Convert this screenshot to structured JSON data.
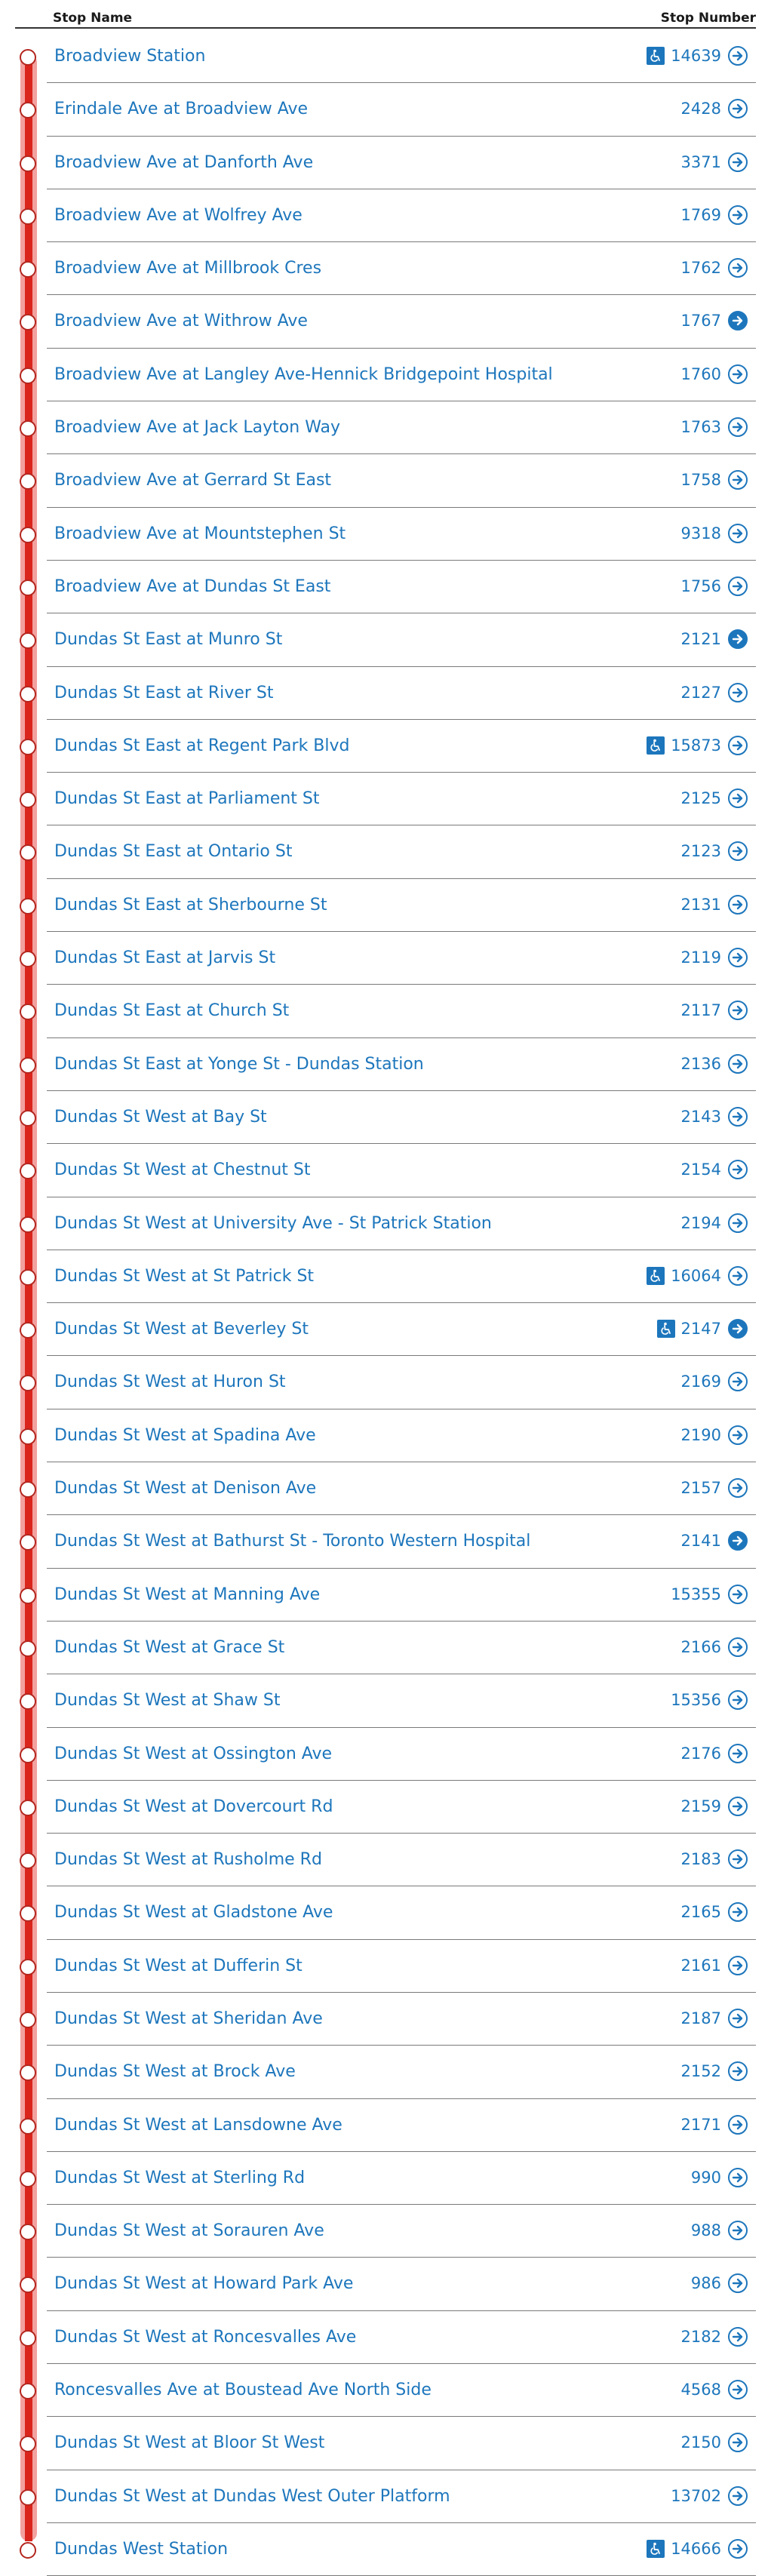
{
  "header": {
    "name_label": "Stop Name",
    "number_label": "Stop Number"
  },
  "colors": {
    "route_line": "#da251d",
    "link": "#1d76bc"
  },
  "stops": [
    {
      "name": "Broadview Station",
      "number": "14639",
      "accessible": true,
      "arrow": "outline"
    },
    {
      "name": "Erindale Ave at Broadview Ave",
      "number": "2428",
      "accessible": false,
      "arrow": "outline"
    },
    {
      "name": "Broadview Ave at Danforth Ave",
      "number": "3371",
      "accessible": false,
      "arrow": "outline"
    },
    {
      "name": "Broadview Ave at Wolfrey Ave",
      "number": "1769",
      "accessible": false,
      "arrow": "outline"
    },
    {
      "name": "Broadview Ave at Millbrook Cres",
      "number": "1762",
      "accessible": false,
      "arrow": "outline"
    },
    {
      "name": "Broadview Ave at Withrow Ave",
      "number": "1767",
      "accessible": false,
      "arrow": "filled"
    },
    {
      "name": "Broadview Ave at Langley Ave-Hennick Bridgepoint Hospital",
      "number": "1760",
      "accessible": false,
      "arrow": "outline"
    },
    {
      "name": "Broadview Ave at Jack Layton Way",
      "number": "1763",
      "accessible": false,
      "arrow": "outline"
    },
    {
      "name": "Broadview Ave at Gerrard St East",
      "number": "1758",
      "accessible": false,
      "arrow": "outline"
    },
    {
      "name": "Broadview Ave at Mountstephen St",
      "number": "9318",
      "accessible": false,
      "arrow": "outline"
    },
    {
      "name": "Broadview Ave at Dundas St East",
      "number": "1756",
      "accessible": false,
      "arrow": "outline"
    },
    {
      "name": "Dundas St East at Munro St",
      "number": "2121",
      "accessible": false,
      "arrow": "filled"
    },
    {
      "name": "Dundas St East at River St",
      "number": "2127",
      "accessible": false,
      "arrow": "outline"
    },
    {
      "name": "Dundas St East at Regent Park Blvd",
      "number": "15873",
      "accessible": true,
      "arrow": "outline"
    },
    {
      "name": "Dundas St East at Parliament St",
      "number": "2125",
      "accessible": false,
      "arrow": "outline"
    },
    {
      "name": "Dundas St East at Ontario St",
      "number": "2123",
      "accessible": false,
      "arrow": "outline"
    },
    {
      "name": "Dundas St East at Sherbourne St",
      "number": "2131",
      "accessible": false,
      "arrow": "outline"
    },
    {
      "name": "Dundas St East at Jarvis St",
      "number": "2119",
      "accessible": false,
      "arrow": "outline"
    },
    {
      "name": "Dundas St East at Church St",
      "number": "2117",
      "accessible": false,
      "arrow": "outline"
    },
    {
      "name": "Dundas St East at Yonge St - Dundas Station",
      "number": "2136",
      "accessible": false,
      "arrow": "outline"
    },
    {
      "name": "Dundas St West at Bay St",
      "number": "2143",
      "accessible": false,
      "arrow": "outline"
    },
    {
      "name": "Dundas St West at Chestnut St",
      "number": "2154",
      "accessible": false,
      "arrow": "outline"
    },
    {
      "name": "Dundas St West at University Ave - St Patrick Station",
      "number": "2194",
      "accessible": false,
      "arrow": "outline"
    },
    {
      "name": "Dundas St West at St Patrick St",
      "number": "16064",
      "accessible": true,
      "arrow": "outline"
    },
    {
      "name": "Dundas St West at Beverley St",
      "number": "2147",
      "accessible": true,
      "arrow": "filled"
    },
    {
      "name": "Dundas St West at Huron St",
      "number": "2169",
      "accessible": false,
      "arrow": "outline"
    },
    {
      "name": "Dundas St West at Spadina Ave",
      "number": "2190",
      "accessible": false,
      "arrow": "outline"
    },
    {
      "name": "Dundas St West at Denison Ave",
      "number": "2157",
      "accessible": false,
      "arrow": "outline"
    },
    {
      "name": "Dundas St West at Bathurst St - Toronto Western Hospital",
      "number": "2141",
      "accessible": false,
      "arrow": "filled"
    },
    {
      "name": "Dundas St West at Manning Ave",
      "number": "15355",
      "accessible": false,
      "arrow": "outline"
    },
    {
      "name": "Dundas St West at Grace St",
      "number": "2166",
      "accessible": false,
      "arrow": "outline"
    },
    {
      "name": "Dundas St West at Shaw St",
      "number": "15356",
      "accessible": false,
      "arrow": "outline"
    },
    {
      "name": "Dundas St West at Ossington Ave",
      "number": "2176",
      "accessible": false,
      "arrow": "outline"
    },
    {
      "name": "Dundas St West at Dovercourt Rd",
      "number": "2159",
      "accessible": false,
      "arrow": "outline"
    },
    {
      "name": "Dundas St West at Rusholme Rd",
      "number": "2183",
      "accessible": false,
      "arrow": "outline"
    },
    {
      "name": "Dundas St West at Gladstone Ave",
      "number": "2165",
      "accessible": false,
      "arrow": "outline"
    },
    {
      "name": "Dundas St West at Dufferin St",
      "number": "2161",
      "accessible": false,
      "arrow": "outline"
    },
    {
      "name": "Dundas St West at Sheridan Ave",
      "number": "2187",
      "accessible": false,
      "arrow": "outline"
    },
    {
      "name": "Dundas St West at Brock Ave",
      "number": "2152",
      "accessible": false,
      "arrow": "outline"
    },
    {
      "name": "Dundas St West at Lansdowne Ave",
      "number": "2171",
      "accessible": false,
      "arrow": "outline"
    },
    {
      "name": "Dundas St West at Sterling Rd",
      "number": "990",
      "accessible": false,
      "arrow": "outline"
    },
    {
      "name": "Dundas St West at Sorauren Ave",
      "number": "988",
      "accessible": false,
      "arrow": "outline"
    },
    {
      "name": "Dundas St West at Howard Park Ave",
      "number": "986",
      "accessible": false,
      "arrow": "outline"
    },
    {
      "name": "Dundas St West at Roncesvalles Ave",
      "number": "2182",
      "accessible": false,
      "arrow": "outline"
    },
    {
      "name": "Roncesvalles Ave at Boustead Ave North Side",
      "number": "4568",
      "accessible": false,
      "arrow": "outline"
    },
    {
      "name": "Dundas St West at Bloor St West",
      "number": "2150",
      "accessible": false,
      "arrow": "outline"
    },
    {
      "name": "Dundas St West at Dundas West Outer Platform",
      "number": "13702",
      "accessible": false,
      "arrow": "outline"
    },
    {
      "name": "Dundas West Station",
      "number": "14666",
      "accessible": true,
      "arrow": "outline"
    }
  ]
}
